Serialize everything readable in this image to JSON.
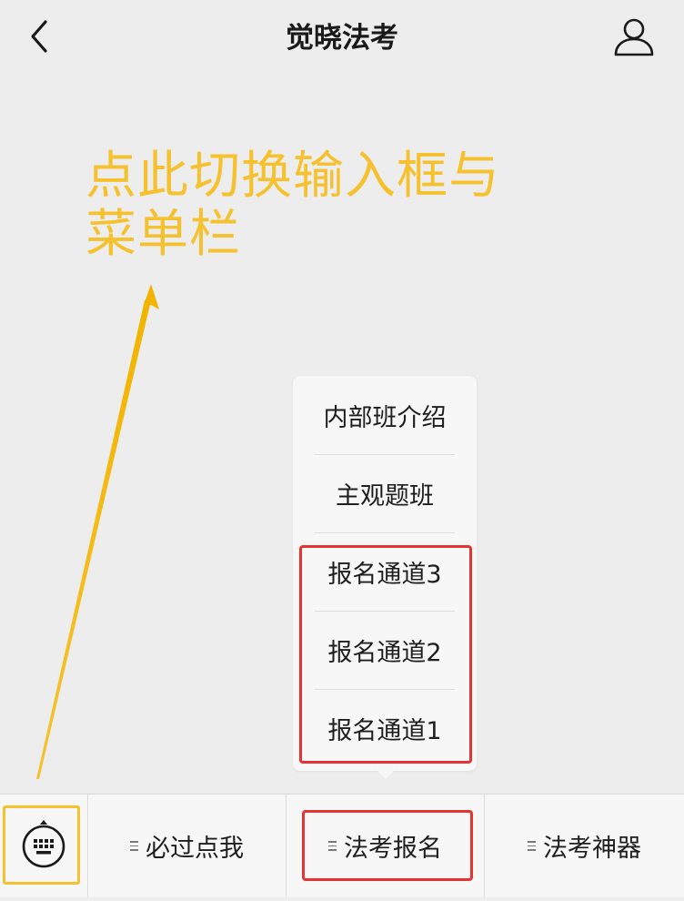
{
  "header": {
    "title": "觉晓法考",
    "back_icon": "chevron-left-icon",
    "profile_icon": "user-icon"
  },
  "annotation": {
    "line1": "点此切换输入框与",
    "line2": "菜单栏",
    "color": "#f6c12f"
  },
  "popup_menu": {
    "items": [
      {
        "label": "内部班介绍"
      },
      {
        "label": "主观题班"
      },
      {
        "label": "报名通道3"
      },
      {
        "label": "报名通道2"
      },
      {
        "label": "报名通道1"
      }
    ]
  },
  "bottom_menu": {
    "keyboard_icon": "keyboard-icon",
    "menu_icon": "menu-lines-icon",
    "buttons": [
      {
        "label": "必过点我"
      },
      {
        "label": "法考报名"
      },
      {
        "label": "法考神器"
      }
    ]
  },
  "colors": {
    "highlight_red": "#e53333",
    "highlight_yellow": "#f6c12f",
    "background": "#ededed"
  }
}
